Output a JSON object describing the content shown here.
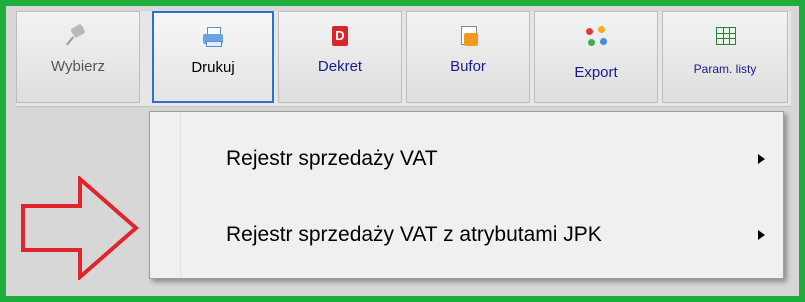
{
  "toolbar": {
    "buttons": [
      {
        "label": "Wybierz",
        "icon": "pin-icon"
      },
      {
        "label": "Drukuj",
        "icon": "printer-icon"
      },
      {
        "label": "Dekret",
        "icon": "dekret-icon",
        "icon_text": "D"
      },
      {
        "label": "Bufor",
        "icon": "bufor-icon"
      },
      {
        "label": "Export",
        "icon": "export-icon"
      },
      {
        "label": "Param. listy",
        "icon": "table-grid-icon"
      }
    ]
  },
  "menu": {
    "items": [
      {
        "label": "Rejestr sprzedaży VAT"
      },
      {
        "label": "Rejestr sprzedaży VAT z atrybutami JPK"
      }
    ]
  },
  "colors": {
    "frame_border": "#1fae3c",
    "annotation_arrow": "#e0262c",
    "active_button_border": "#2f6fcd",
    "button_label": "#1a1a8c"
  }
}
